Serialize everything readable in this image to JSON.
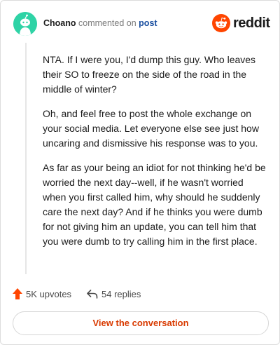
{
  "header": {
    "username": "Choano",
    "action_text": " commented on ",
    "post_link": "post",
    "brand_text": "reddit"
  },
  "comment": {
    "paragraphs": [
      "NTA. If I were you, I'd dump this guy. Who leaves their SO to freeze on the side of the road in the middle of winter?",
      "Oh, and feel free to post the whole exchange on your social media. Let everyone else see just how uncaring and dismissive his response was to you.",
      "As far as your being an idiot for not thinking he'd be worried the next day--well, if he wasn't worried when you first called him, why should he suddenly care the next day? And if he thinks you were dumb for not giving him an update, you can tell him that you were dumb to try calling him in the first place."
    ]
  },
  "actions": {
    "upvotes_label": "5K upvotes",
    "replies_label": "54 replies"
  },
  "cta": {
    "label": "View the conversation"
  },
  "colors": {
    "avatar_bg": "#2fd3a6",
    "reddit_orange": "#ff4500",
    "cta_text": "#d93a00",
    "link": "#1a4fa0"
  },
  "icons": {
    "avatar": "snoo-avatar-icon",
    "brand": "reddit-logo-icon",
    "upvote": "upvote-arrow-icon",
    "reply": "reply-arrow-icon"
  }
}
